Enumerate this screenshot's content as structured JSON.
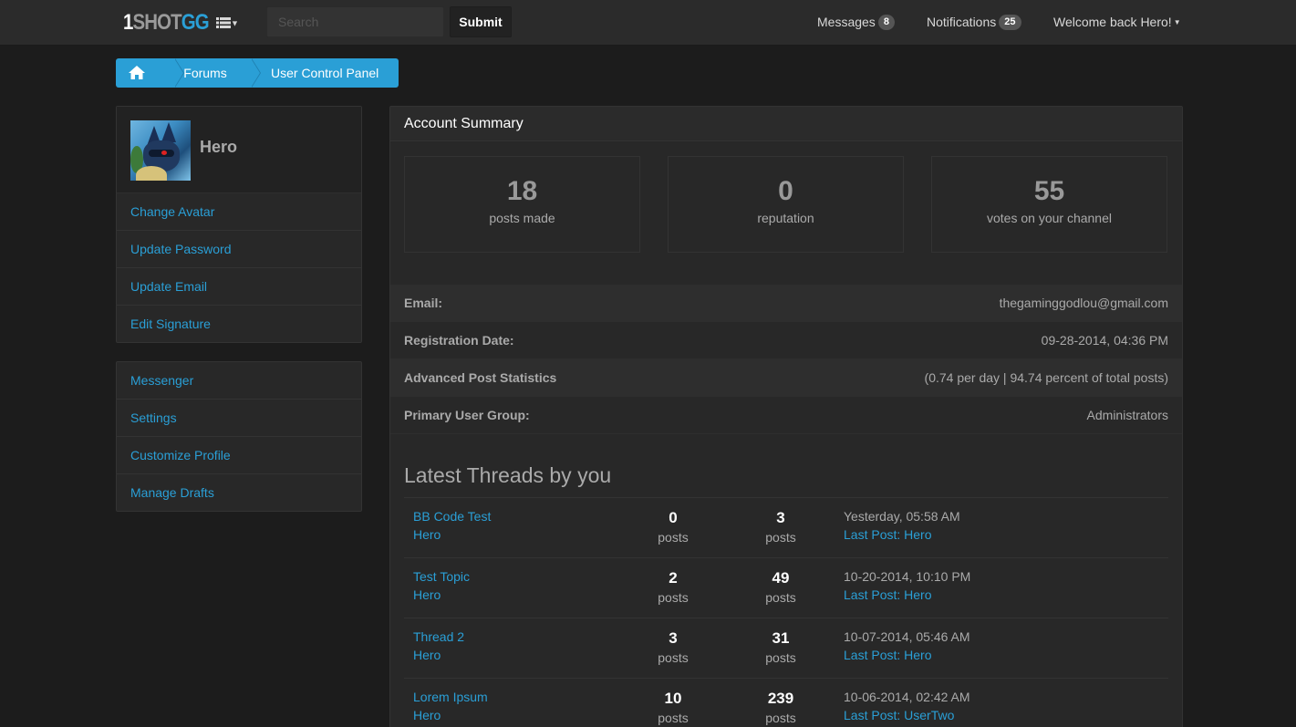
{
  "navbar": {
    "brand_part1": "1",
    "brand_part2": "SHOT",
    "brand_part3": "GG",
    "search_placeholder": "Search",
    "submit_label": "Submit",
    "messages_label": "Messages",
    "messages_count": "8",
    "notifications_label": "Notifications",
    "notifications_count": "25",
    "welcome_label": "Welcome back Hero!"
  },
  "breadcrumb": {
    "items": [
      {
        "label": "Forums"
      },
      {
        "label": "User Control Panel"
      }
    ]
  },
  "profile": {
    "username": "Hero",
    "menu": [
      {
        "label": "Change Avatar"
      },
      {
        "label": "Update Password"
      },
      {
        "label": "Update Email"
      },
      {
        "label": "Edit Signature"
      }
    ]
  },
  "secondary_menu": [
    {
      "label": "Messenger"
    },
    {
      "label": "Settings"
    },
    {
      "label": "Customize Profile"
    },
    {
      "label": "Manage Drafts"
    }
  ],
  "summary": {
    "title": "Account Summary",
    "stats": [
      {
        "value": "18",
        "label": "posts made"
      },
      {
        "value": "0",
        "label": "reputation"
      },
      {
        "value": "55",
        "label": "votes on your channel"
      }
    ],
    "info": [
      {
        "label": "Email:",
        "value": "thegaminggodlou@gmail.com"
      },
      {
        "label": "Registration Date:",
        "value": "09-28-2014, 04:36 PM"
      },
      {
        "label": "Advanced Post Statistics",
        "value": "(0.74 per day | 94.74 percent of total posts)"
      },
      {
        "label": "Primary User Group:",
        "value": "Administrators"
      }
    ]
  },
  "threads": {
    "title": "Latest Threads by you",
    "rows": [
      {
        "title": "BB Code Test",
        "author": "Hero",
        "replies": "0",
        "replies_unit": "posts",
        "views": "3",
        "views_unit": "posts",
        "date": "Yesterday, 05:58 AM",
        "last_post": "Last Post: Hero"
      },
      {
        "title": "Test Topic",
        "author": "Hero",
        "replies": "2",
        "replies_unit": "posts",
        "views": "49",
        "views_unit": "posts",
        "date": "10-20-2014, 10:10 PM",
        "last_post": "Last Post: Hero"
      },
      {
        "title": "Thread 2",
        "author": "Hero",
        "replies": "3",
        "replies_unit": "posts",
        "views": "31",
        "views_unit": "posts",
        "date": "10-07-2014, 05:46 AM",
        "last_post": "Last Post: Hero"
      },
      {
        "title": "Lorem Ipsum",
        "author": "Hero",
        "replies": "10",
        "replies_unit": "posts",
        "views": "239",
        "views_unit": "posts",
        "date": "10-06-2014, 02:42 AM",
        "last_post": "Last Post: UserTwo"
      }
    ]
  },
  "colors": {
    "accent": "#2a9fd6",
    "background": "#1c1c1c",
    "panel": "#282828",
    "navbar": "#2b2b2b"
  }
}
